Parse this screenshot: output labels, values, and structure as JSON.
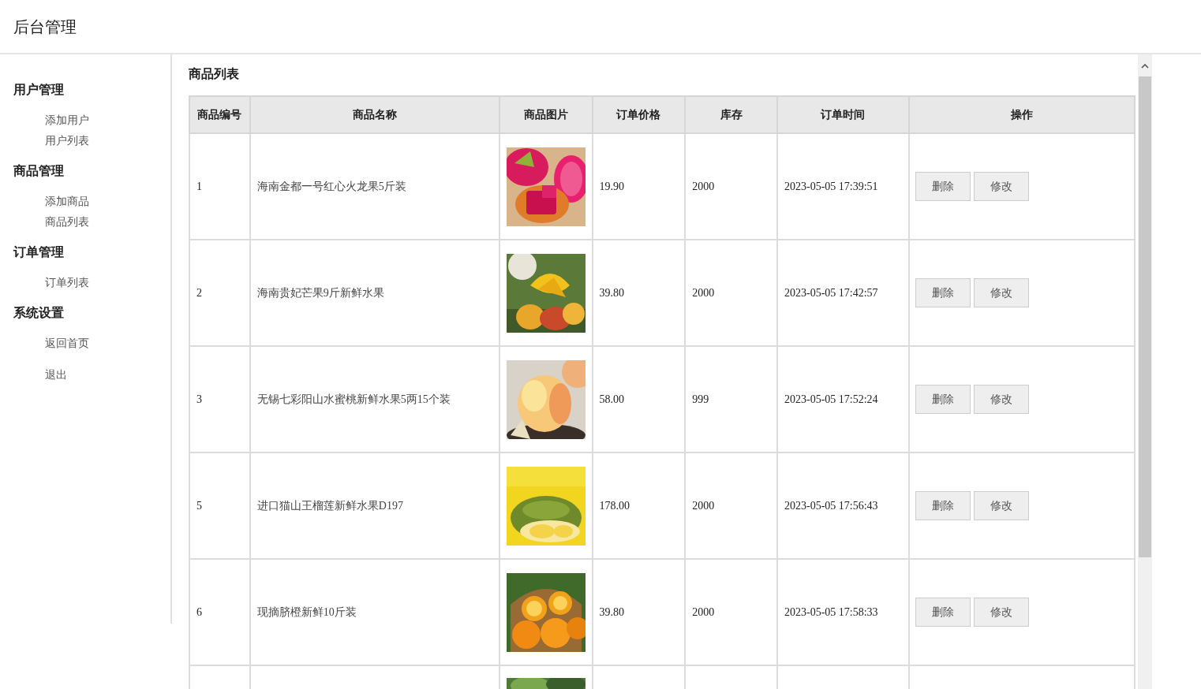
{
  "header": {
    "title": "后台管理"
  },
  "sidebar": {
    "groups": [
      {
        "label": "用户管理",
        "items": [
          "添加用户",
          "用户列表"
        ]
      },
      {
        "label": "商品管理",
        "items": [
          "添加商品",
          "商品列表"
        ]
      },
      {
        "label": "订单管理",
        "items": [
          "订单列表"
        ]
      },
      {
        "label": "系统设置",
        "items": [
          "返回首页",
          "退出"
        ]
      }
    ]
  },
  "content": {
    "title": "商品列表",
    "table": {
      "columns": [
        "商品编号",
        "商品名称",
        "商品图片",
        "订单价格",
        "库存",
        "订单时间",
        "操作"
      ],
      "rows": [
        {
          "kind": "product",
          "id": "1",
          "name": "海南金都一号红心火龙果5斤装",
          "price": "19.90",
          "stock": "2000",
          "time": "2023-05-05 17:39:51",
          "actions": [
            "删除",
            "修改"
          ]
        },
        {
          "kind": "product",
          "id": "2",
          "name": "海南贵妃芒果9斤新鲜水果",
          "price": "39.80",
          "stock": "2000",
          "time": "2023-05-05 17:42:57",
          "actions": [
            "删除",
            "修改"
          ]
        },
        {
          "kind": "product",
          "id": "3",
          "name": "无锡七彩阳山水蜜桃新鲜水果5两15个装",
          "price": "58.00",
          "stock": "999",
          "time": "2023-05-05 17:52:24",
          "actions": [
            "删除",
            "修改"
          ]
        },
        {
          "kind": "product",
          "id": "5",
          "name": "进口猫山王榴莲新鲜水果D197",
          "price": "178.00",
          "stock": "2000",
          "time": "2023-05-05 17:56:43",
          "actions": [
            "删除",
            "修改"
          ]
        },
        {
          "kind": "product",
          "id": "6",
          "name": "现摘脐橙新鲜10斤装",
          "price": "39.80",
          "stock": "2000",
          "time": "2023-05-05 17:58:33",
          "actions": [
            "删除",
            "修改"
          ]
        },
        {
          "kind": "cut_off"
        }
      ]
    }
  }
}
